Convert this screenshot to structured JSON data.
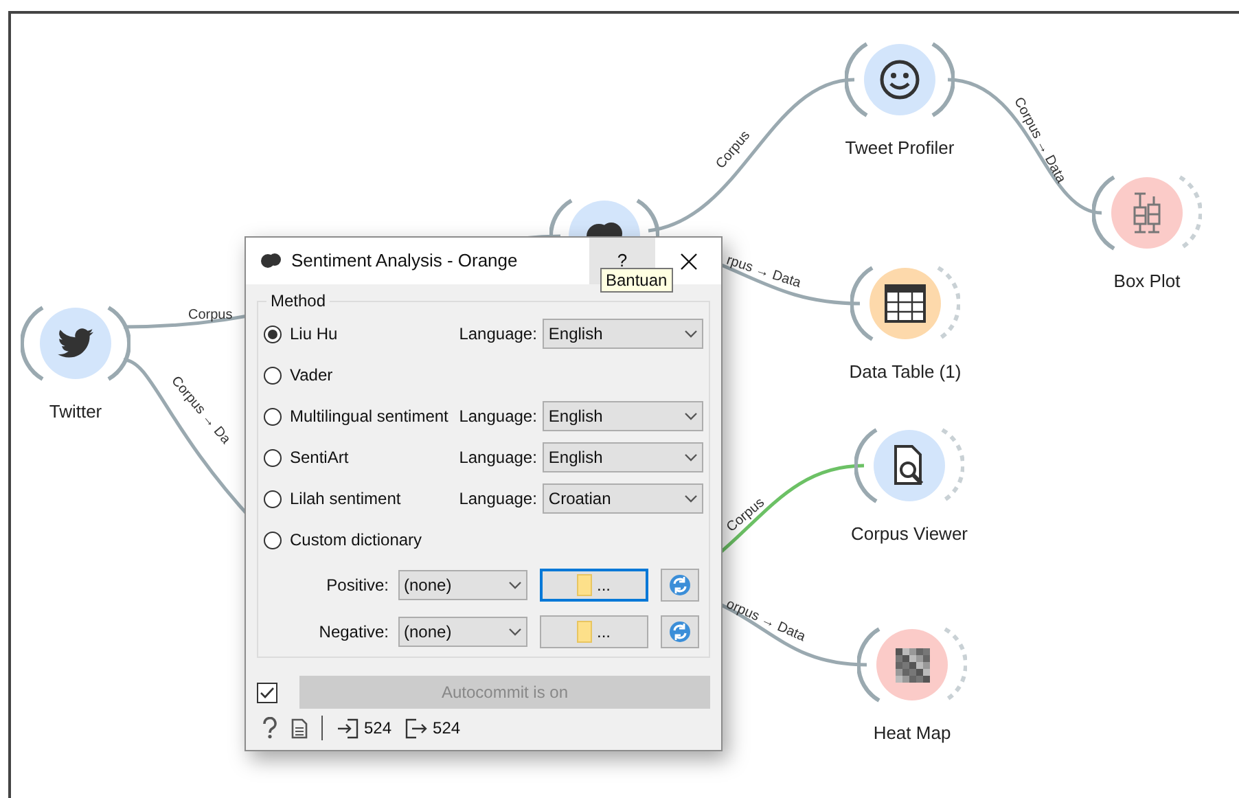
{
  "canvas": {
    "nodes": [
      {
        "kind": "twitter",
        "label": "Twitter",
        "color": "#d3e5fb",
        "has_output_links": true
      },
      {
        "kind": "sentiment",
        "color": "#d3e5fb",
        "has_output_links": true
      },
      {
        "kind": "tweet_profiler",
        "label": "Tweet Profiler",
        "color": "#d3e5fb",
        "has_output_links": true
      },
      {
        "kind": "box_plot",
        "label": "Box Plot",
        "color": "#fbcbc8",
        "has_output_links": false
      },
      {
        "kind": "data_table",
        "label": "Data Table (1)",
        "color": "#fdd9ab",
        "has_output_links": false
      },
      {
        "kind": "corpus_viewer",
        "label": "Corpus Viewer",
        "color": "#d3e5fb",
        "has_output_links": false
      },
      {
        "kind": "heat_map",
        "label": "Heat Map",
        "color": "#fbcbc8",
        "has_output_links": false
      }
    ],
    "links": [
      {
        "label": "Corpus",
        "color": "#9aa9b0"
      },
      {
        "label": "Corpus → Da",
        "color": "#9aa9b0"
      },
      {
        "label": "Corpus",
        "color": "#9aa9b0"
      },
      {
        "label": "Corpus → Data",
        "color": "#9aa9b0"
      },
      {
        "label": "rpus → Data",
        "color": "#9aa9b0"
      },
      {
        "label": "Corpus",
        "color": "#6cc165"
      },
      {
        "label": "orpus → Data",
        "color": "#9aa9b0"
      }
    ]
  },
  "dialog": {
    "title": "Sentiment Analysis - Orange",
    "help_button": "?",
    "tooltip": "Bantuan",
    "method": {
      "title": "Method",
      "options": [
        {
          "label": "Liu Hu",
          "selected": true,
          "language_label": "Language:",
          "language": "English"
        },
        {
          "label": "Vader",
          "selected": false
        },
        {
          "label": "Multilingual sentiment",
          "selected": false,
          "language_label": "Language:",
          "language": "English"
        },
        {
          "label": "SentiArt",
          "selected": false,
          "language_label": "Language:",
          "language": "English"
        },
        {
          "label": "Lilah sentiment",
          "selected": false,
          "language_label": "Language:",
          "language": "Croatian"
        },
        {
          "label": "Custom dictionary",
          "selected": false
        }
      ],
      "dictionaries": [
        {
          "label": "Positive:",
          "value": "(none)",
          "browse": "...",
          "focused": true
        },
        {
          "label": "Negative:",
          "value": "(none)",
          "browse": "...",
          "focused": false
        }
      ]
    },
    "autocommit": {
      "checked": true,
      "label": "Autocommit is on"
    },
    "status": {
      "input_count": "524",
      "output_count": "524"
    }
  }
}
